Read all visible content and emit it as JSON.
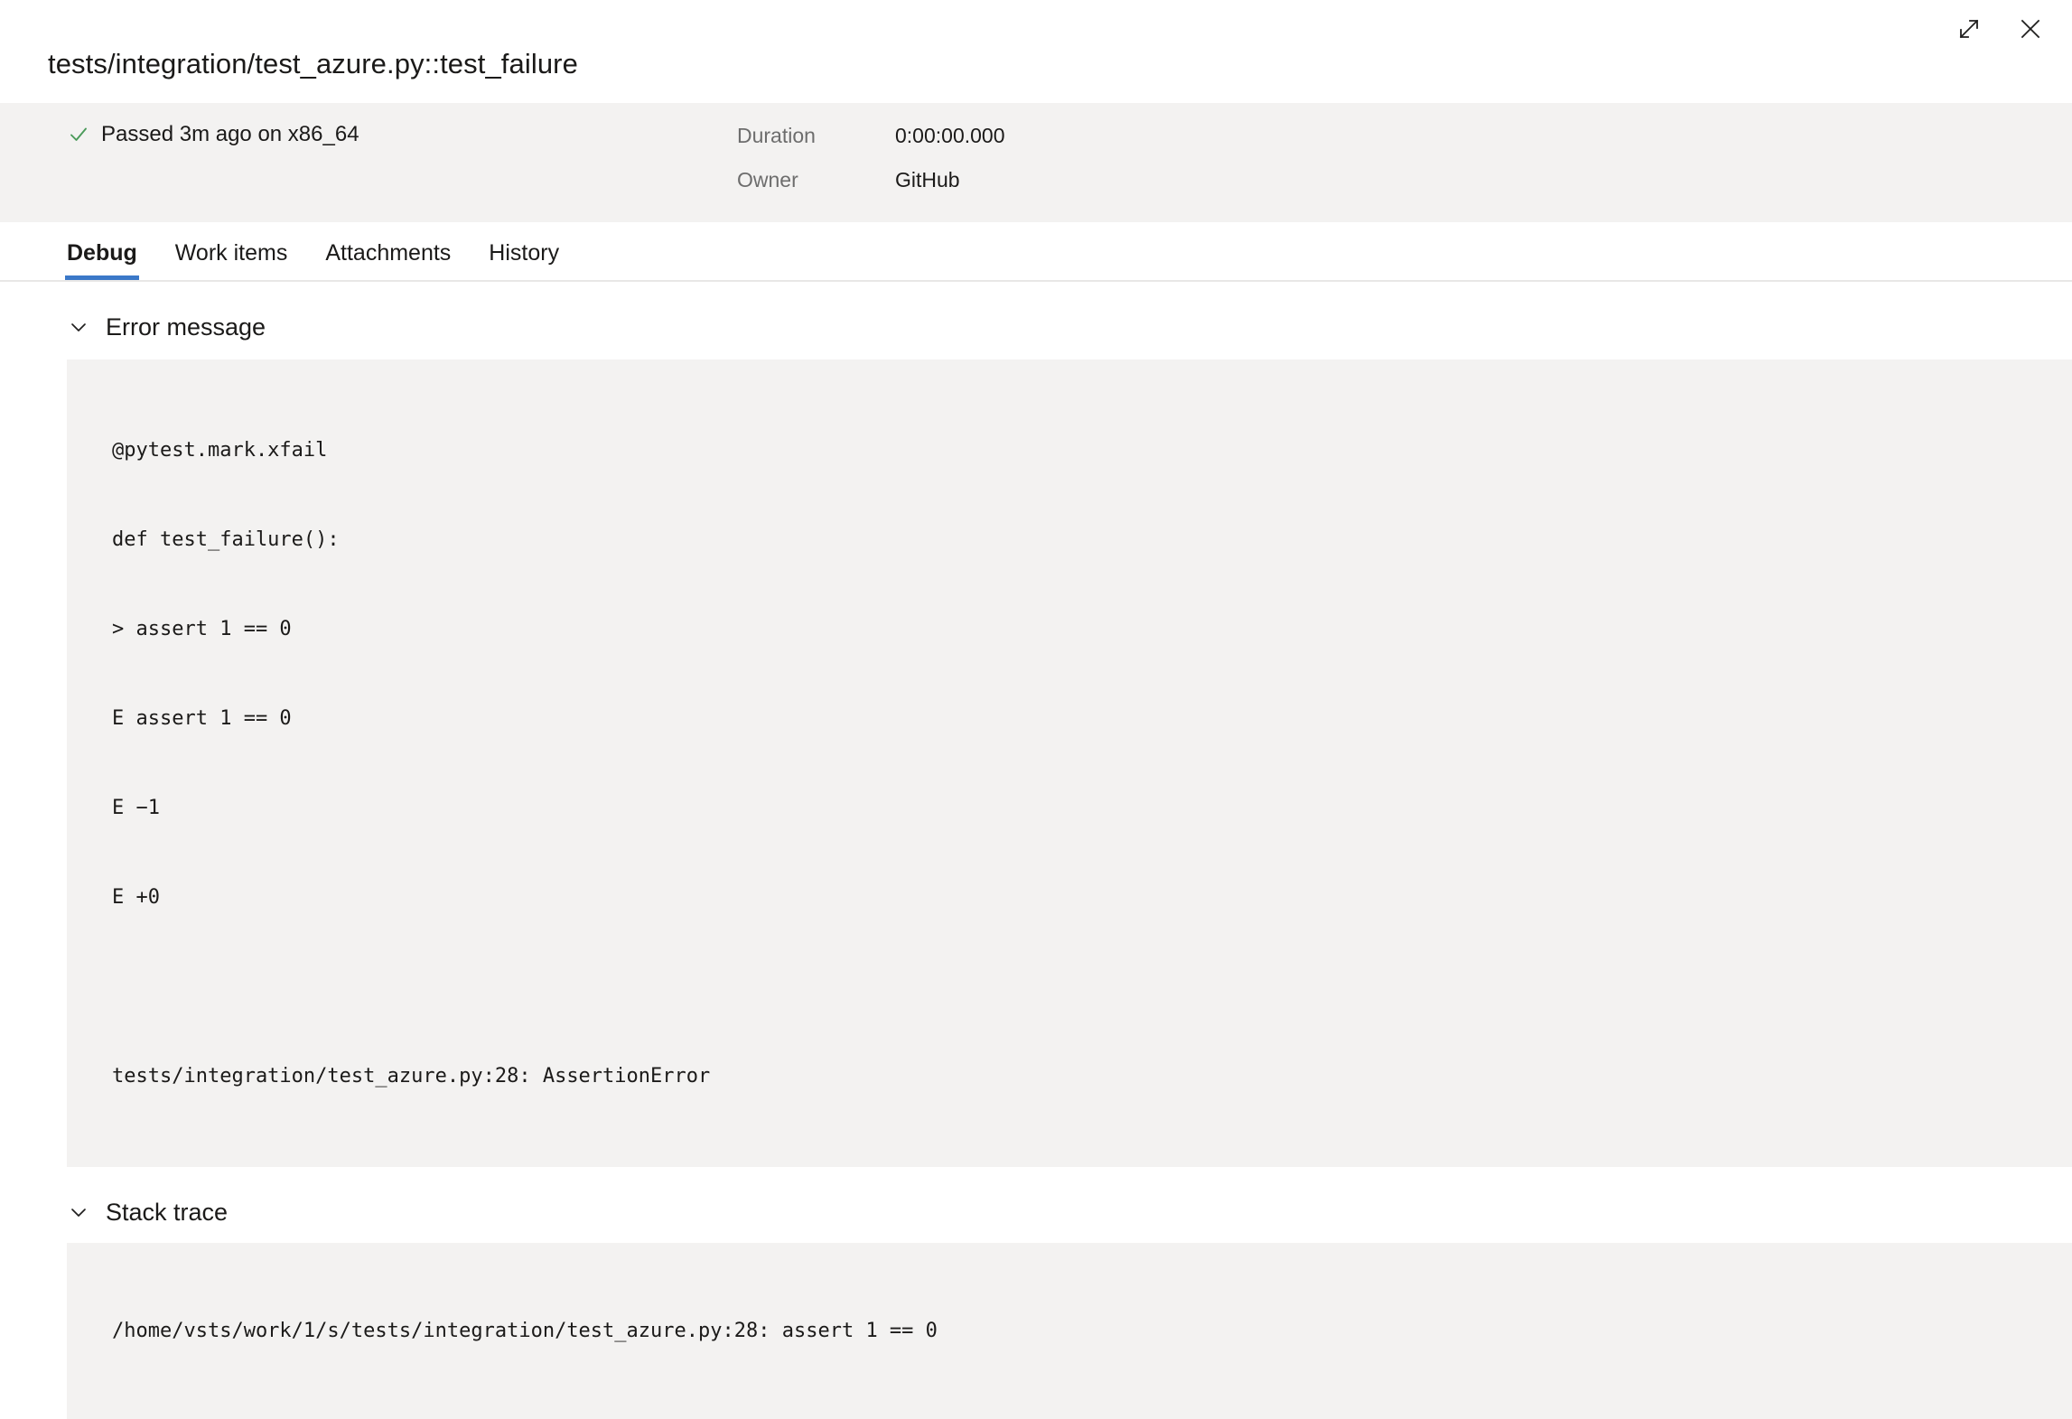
{
  "window": {
    "expand_label": "Expand",
    "close_label": "Close"
  },
  "header": {
    "title": "tests/integration/test_azure.py::test_failure"
  },
  "summary": {
    "status_icon": "check-icon",
    "status_color": "#4a9a5a",
    "outcome_text": "Passed 3m ago on x86_64",
    "meta": [
      {
        "label": "Duration",
        "value": "0:00:00.000"
      },
      {
        "label": "Owner",
        "value": "GitHub"
      }
    ]
  },
  "tabs": {
    "accent_color": "#3b78c8",
    "items": [
      {
        "label": "Debug",
        "active": true
      },
      {
        "label": "Work items",
        "active": false
      },
      {
        "label": "Attachments",
        "active": false
      },
      {
        "label": "History",
        "active": false
      }
    ]
  },
  "sections": [
    {
      "title": "Error message",
      "expanded": true,
      "lines": [
        "@pytest.mark.xfail",
        "def test_failure():",
        "> assert 1 == 0",
        "E assert 1 == 0",
        "E −1",
        "E +0",
        "",
        "tests/integration/test_azure.py:28: AssertionError"
      ]
    },
    {
      "title": "Stack trace",
      "expanded": true,
      "lines": [
        "/home/vsts/work/1/s/tests/integration/test_azure.py:28: assert 1 == 0"
      ]
    }
  ]
}
